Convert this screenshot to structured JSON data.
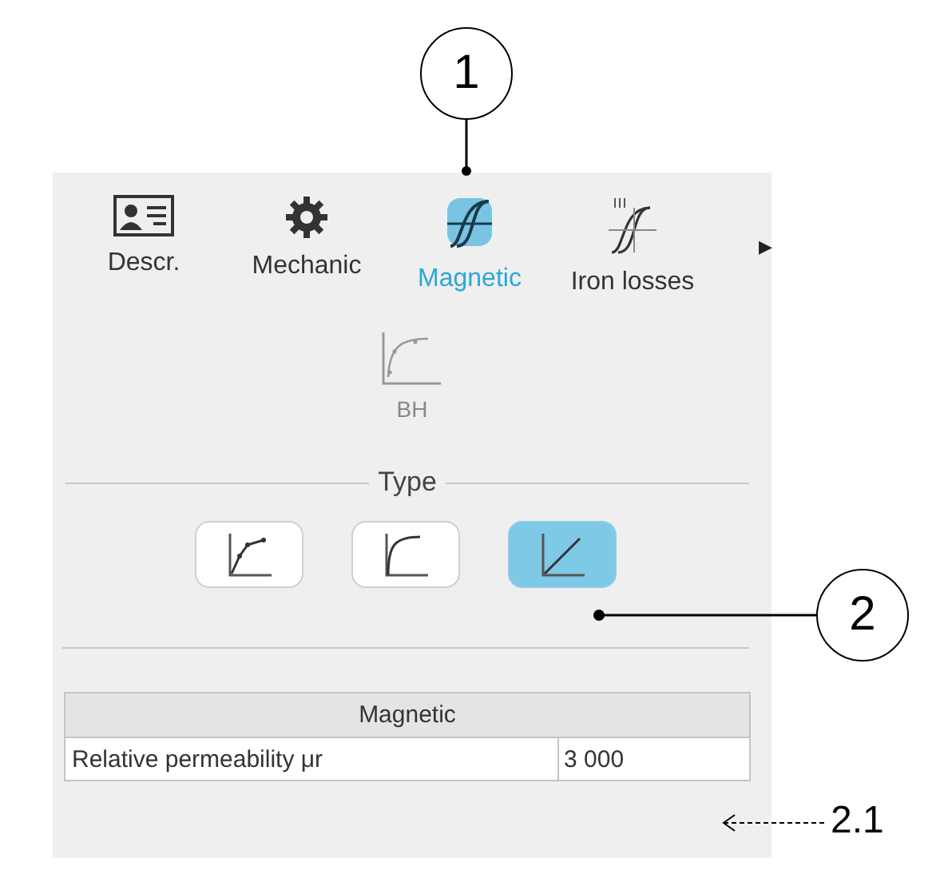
{
  "tabs": [
    {
      "kind": "card",
      "label": "Descr.",
      "selected": false
    },
    {
      "kind": "gear",
      "label": "Mechanic",
      "selected": false
    },
    {
      "kind": "magnetic",
      "label": "Magnetic",
      "selected": true
    },
    {
      "kind": "losses",
      "label": "Iron losses",
      "selected": false
    }
  ],
  "more_arrow": "▶",
  "sub_tool": {
    "label": "BH"
  },
  "type_section": {
    "title": "Type",
    "buttons": [
      {
        "kind": "points",
        "selected": false
      },
      {
        "kind": "curve",
        "selected": false
      },
      {
        "kind": "linear",
        "selected": true
      }
    ]
  },
  "table": {
    "title": "Magnetic",
    "rows": [
      {
        "label": "Relative permeability μr",
        "value": "3 000"
      }
    ]
  },
  "callouts": [
    {
      "kind": "circle",
      "label": "1"
    },
    {
      "kind": "circle",
      "label": "2"
    },
    {
      "kind": "plain",
      "label": "2.1"
    }
  ]
}
